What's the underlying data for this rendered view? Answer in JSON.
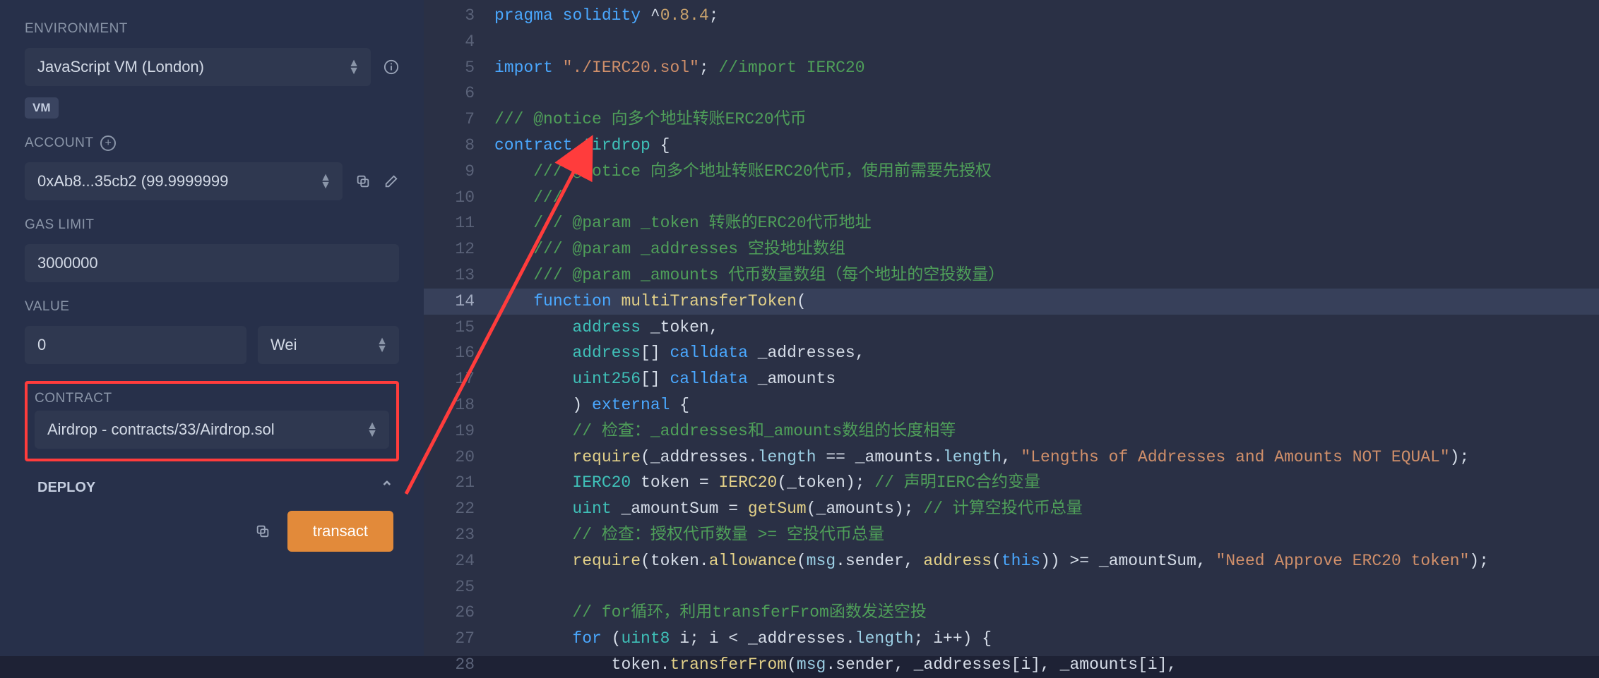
{
  "sidebar": {
    "environment_label": "ENVIRONMENT",
    "environment_value": "JavaScript VM (London)",
    "vm_badge": "VM",
    "account_label": "ACCOUNT",
    "account_value": "0xAb8...35cb2 (99.9999999",
    "gas_label": "GAS LIMIT",
    "gas_value": "3000000",
    "value_label": "VALUE",
    "value_amount": "0",
    "value_unit": "Wei",
    "contract_label": "CONTRACT",
    "contract_value": "Airdrop - contracts/33/Airdrop.sol",
    "deploy_label": "DEPLOY",
    "transact_label": "transact"
  },
  "editor": {
    "first_line": 3,
    "highlight_line": 14,
    "lines": [
      [
        [
          "kw",
          "pragma"
        ],
        [
          "pn",
          " "
        ],
        [
          "kw",
          "solidity"
        ],
        [
          "pn",
          " "
        ],
        [
          "op",
          "^"
        ],
        [
          "nm",
          "0.8.4"
        ],
        [
          "pn",
          ";"
        ]
      ],
      [],
      [
        [
          "kw",
          "import"
        ],
        [
          "pn",
          " "
        ],
        [
          "str",
          "\"./IERC20.sol\""
        ],
        [
          "pn",
          "; "
        ],
        [
          "cm",
          "//import IERC20"
        ]
      ],
      [],
      [
        [
          "cm",
          "/// @notice 向多个地址转账ERC20代币"
        ]
      ],
      [
        [
          "kw",
          "contract"
        ],
        [
          "pn",
          " "
        ],
        [
          "ty",
          "Airdrop"
        ],
        [
          "pn",
          " {"
        ]
      ],
      [
        [
          "pn",
          "    "
        ],
        [
          "cm",
          "/// @notice 向多个地址转账ERC20代币，使用前需要先授权"
        ]
      ],
      [
        [
          "pn",
          "    "
        ],
        [
          "cm",
          "///"
        ]
      ],
      [
        [
          "pn",
          "    "
        ],
        [
          "cm",
          "/// @param _token 转账的ERC20代币地址"
        ]
      ],
      [
        [
          "pn",
          "    "
        ],
        [
          "cm",
          "/// @param _addresses 空投地址数组"
        ]
      ],
      [
        [
          "pn",
          "    "
        ],
        [
          "cm",
          "/// @param _amounts 代币数量数组（每个地址的空投数量）"
        ]
      ],
      [
        [
          "pn",
          "    "
        ],
        [
          "kw",
          "function"
        ],
        [
          "pn",
          " "
        ],
        [
          "fn",
          "multiTransferToken"
        ],
        [
          "pn",
          "("
        ]
      ],
      [
        [
          "pn",
          "        "
        ],
        [
          "ty",
          "address"
        ],
        [
          "pn",
          " "
        ],
        [
          "id",
          "_token"
        ],
        [
          "pn",
          ","
        ]
      ],
      [
        [
          "pn",
          "        "
        ],
        [
          "ty",
          "address"
        ],
        [
          "pn",
          "[] "
        ],
        [
          "mod",
          "calldata"
        ],
        [
          "pn",
          " "
        ],
        [
          "id",
          "_addresses"
        ],
        [
          "pn",
          ","
        ]
      ],
      [
        [
          "pn",
          "        "
        ],
        [
          "ty",
          "uint256"
        ],
        [
          "pn",
          "[] "
        ],
        [
          "mod",
          "calldata"
        ],
        [
          "pn",
          " "
        ],
        [
          "id",
          "_amounts"
        ]
      ],
      [
        [
          "pn",
          "        ) "
        ],
        [
          "mod",
          "external"
        ],
        [
          "pn",
          " {"
        ]
      ],
      [
        [
          "pn",
          "        "
        ],
        [
          "cm",
          "// 检查：_addresses和_amounts数组的长度相等"
        ]
      ],
      [
        [
          "pn",
          "        "
        ],
        [
          "fn",
          "require"
        ],
        [
          "pn",
          "("
        ],
        [
          "id",
          "_addresses"
        ],
        [
          "pn",
          "."
        ],
        [
          "var",
          "length"
        ],
        [
          "pn",
          " == "
        ],
        [
          "id",
          "_amounts"
        ],
        [
          "pn",
          "."
        ],
        [
          "var",
          "length"
        ],
        [
          "pn",
          ", "
        ],
        [
          "str",
          "\"Lengths of Addresses and Amounts NOT EQUAL\""
        ],
        [
          "pn",
          ");"
        ]
      ],
      [
        [
          "pn",
          "        "
        ],
        [
          "ty",
          "IERC20"
        ],
        [
          "pn",
          " "
        ],
        [
          "id",
          "token"
        ],
        [
          "pn",
          " = "
        ],
        [
          "fn",
          "IERC20"
        ],
        [
          "pn",
          "("
        ],
        [
          "id",
          "_token"
        ],
        [
          "pn",
          "); "
        ],
        [
          "cm",
          "// 声明IERC合约变量"
        ]
      ],
      [
        [
          "pn",
          "        "
        ],
        [
          "ty",
          "uint"
        ],
        [
          "pn",
          " "
        ],
        [
          "id",
          "_amountSum"
        ],
        [
          "pn",
          " = "
        ],
        [
          "fn",
          "getSum"
        ],
        [
          "pn",
          "("
        ],
        [
          "id",
          "_amounts"
        ],
        [
          "pn",
          "); "
        ],
        [
          "cm",
          "// 计算空投代币总量"
        ]
      ],
      [
        [
          "pn",
          "        "
        ],
        [
          "cm",
          "// 检查：授权代币数量 >= 空投代币总量"
        ]
      ],
      [
        [
          "pn",
          "        "
        ],
        [
          "fn",
          "require"
        ],
        [
          "pn",
          "("
        ],
        [
          "id",
          "token"
        ],
        [
          "pn",
          "."
        ],
        [
          "fn",
          "allowance"
        ],
        [
          "pn",
          "("
        ],
        [
          "var",
          "msg"
        ],
        [
          "pn",
          "."
        ],
        [
          "id",
          "sender"
        ],
        [
          "pn",
          ", "
        ],
        [
          "fn",
          "address"
        ],
        [
          "pn",
          "("
        ],
        [
          "this",
          "this"
        ],
        [
          "pn",
          ")) >= "
        ],
        [
          "id",
          "_amountSum"
        ],
        [
          "pn",
          ", "
        ],
        [
          "str",
          "\"Need Approve ERC20 token\""
        ],
        [
          "pn",
          ");"
        ]
      ],
      [],
      [
        [
          "pn",
          "        "
        ],
        [
          "cm",
          "// for循环，利用transferFrom函数发送空投"
        ]
      ],
      [
        [
          "pn",
          "        "
        ],
        [
          "kw",
          "for"
        ],
        [
          "pn",
          " ("
        ],
        [
          "ty",
          "uint8"
        ],
        [
          "pn",
          " "
        ],
        [
          "id",
          "i"
        ],
        [
          "pn",
          "; "
        ],
        [
          "id",
          "i"
        ],
        [
          "pn",
          " < "
        ],
        [
          "id",
          "_addresses"
        ],
        [
          "pn",
          "."
        ],
        [
          "var",
          "length"
        ],
        [
          "pn",
          "; "
        ],
        [
          "id",
          "i"
        ],
        [
          "pn",
          "++) {"
        ]
      ],
      [
        [
          "pn",
          "            "
        ],
        [
          "id",
          "token"
        ],
        [
          "pn",
          "."
        ],
        [
          "fn",
          "transferFrom"
        ],
        [
          "pn",
          "("
        ],
        [
          "var",
          "msg"
        ],
        [
          "pn",
          "."
        ],
        [
          "id",
          "sender"
        ],
        [
          "pn",
          ", "
        ],
        [
          "id",
          "_addresses"
        ],
        [
          "pn",
          "["
        ],
        [
          "id",
          "i"
        ],
        [
          "pn",
          "], "
        ],
        [
          "id",
          "_amounts"
        ],
        [
          "pn",
          "["
        ],
        [
          "id",
          "i"
        ],
        [
          "pn",
          "], "
        ]
      ]
    ]
  }
}
